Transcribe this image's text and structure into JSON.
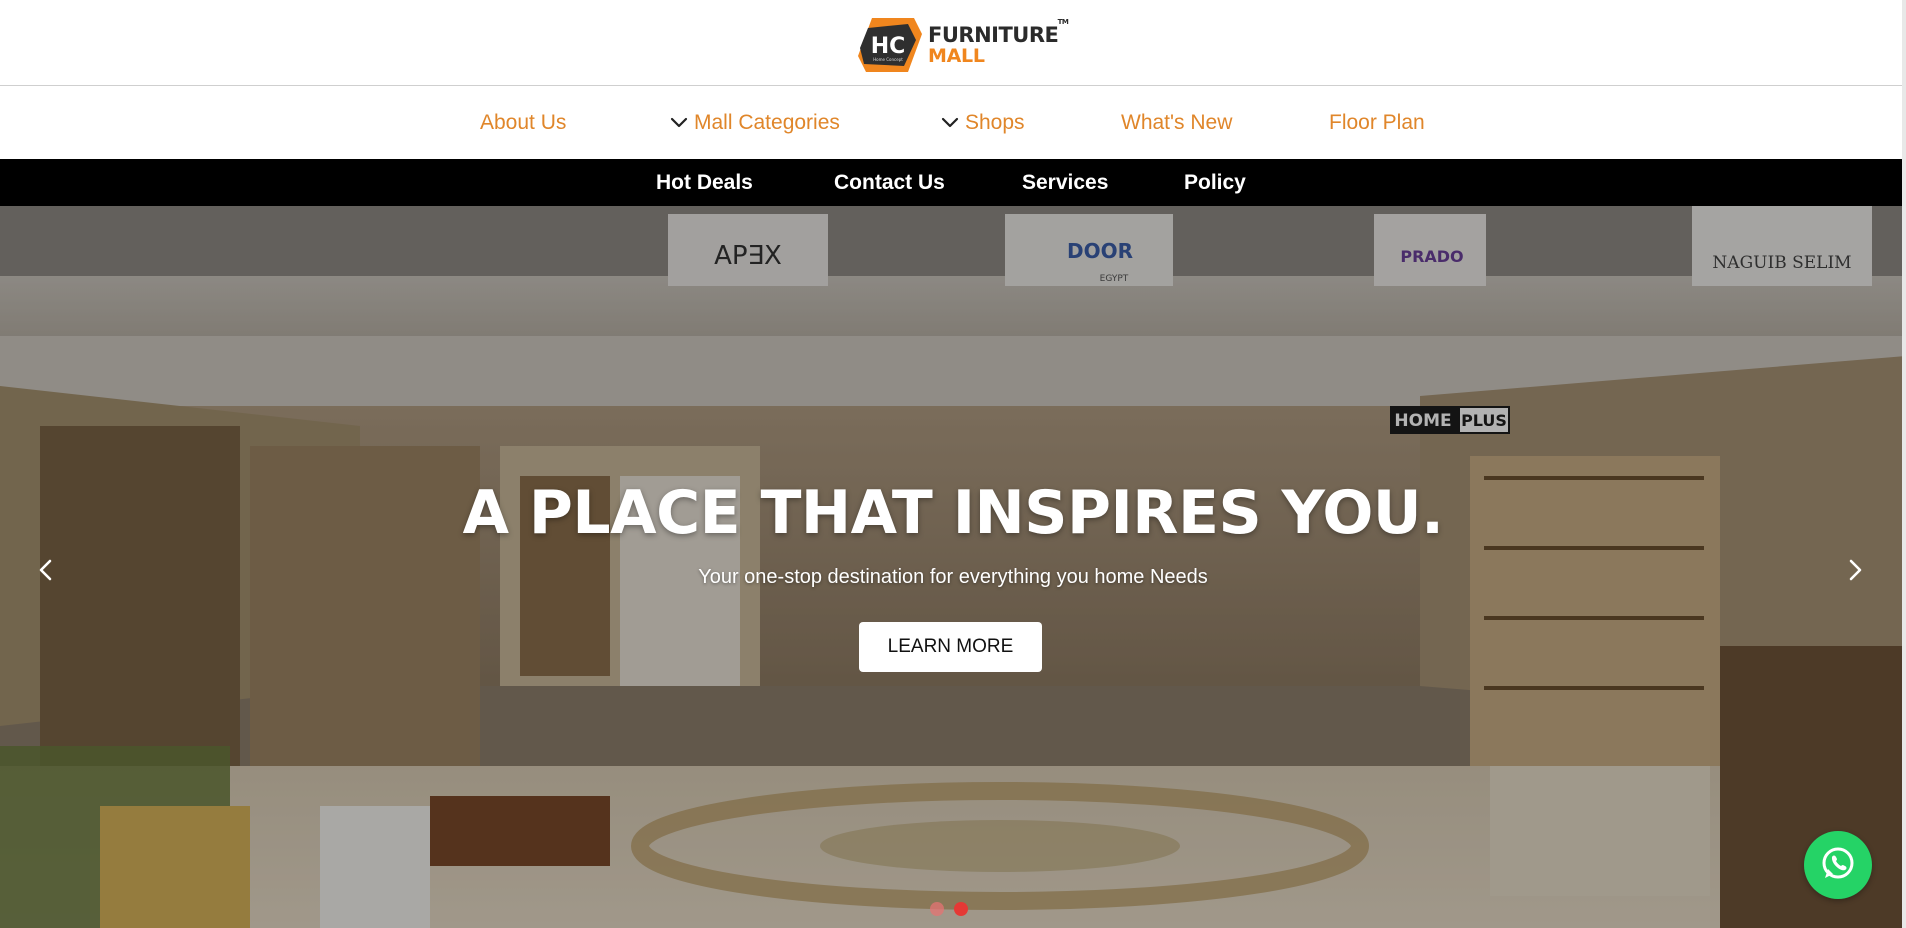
{
  "brand": {
    "badge_text": "HC",
    "badge_subtext": "Home Concept",
    "name_line_1": "FURNITURE",
    "name_line_2": "MALL",
    "trademark": "TM",
    "colors": {
      "orange": "#f0861e",
      "dark": "#2b2b2b"
    }
  },
  "primary_nav": {
    "items": [
      {
        "label": "About Us",
        "has_dropdown": false
      },
      {
        "label": "Mall Categories",
        "has_dropdown": true
      },
      {
        "label": "Shops",
        "has_dropdown": true
      },
      {
        "label": "What's New",
        "has_dropdown": false
      },
      {
        "label": "Floor Plan",
        "has_dropdown": false
      }
    ],
    "color": "#e0862a"
  },
  "secondary_nav": {
    "items": [
      {
        "label": "Hot Deals"
      },
      {
        "label": "Contact Us"
      },
      {
        "label": "Services"
      },
      {
        "label": "Policy"
      }
    ]
  },
  "hero": {
    "title": "A PLACE THAT INSPIRES YOU.",
    "subtitle": "Your one-stop destination for everything you home Needs",
    "cta_label": "LEARN MORE",
    "store_signs": [
      "AP∃X",
      "DOOR",
      "EGYPT",
      "PRADO",
      "NAGUIB SELIM",
      "HOME",
      "PLUS"
    ],
    "carousel": {
      "slide_count": 2,
      "active_index": 1,
      "active_color": "#e53935",
      "inactive_color": "#e57373"
    }
  },
  "icons": {
    "prev": "chevron-left-icon",
    "next": "chevron-right-icon",
    "dropdown": "chevron-down-icon",
    "whatsapp": "whatsapp-icon"
  }
}
